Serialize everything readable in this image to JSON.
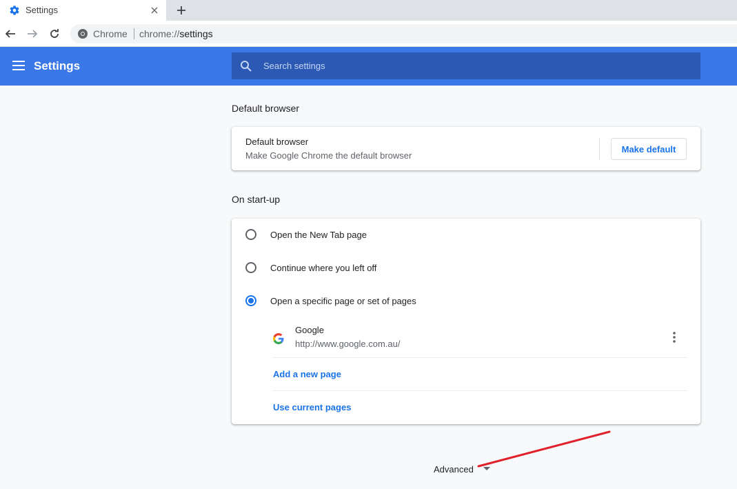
{
  "browser": {
    "tab_title": "Settings",
    "omnibox_chip": "Chrome",
    "url_scheme": "chrome://",
    "url_host": "settings"
  },
  "header": {
    "title": "Settings",
    "search_placeholder": "Search settings",
    "search_value": ""
  },
  "default_browser": {
    "section_title": "Default browser",
    "label": "Default browser",
    "description": "Make Google Chrome the default browser",
    "button_label": "Make default"
  },
  "startup": {
    "section_title": "On start-up",
    "options": [
      {
        "label": "Open the New Tab page",
        "selected": false
      },
      {
        "label": "Continue where you left off",
        "selected": false
      },
      {
        "label": "Open a specific page or set of pages",
        "selected": true
      }
    ],
    "pages": [
      {
        "name": "Google",
        "url": "http://www.google.com.au/"
      }
    ],
    "add_page_label": "Add a new page",
    "use_current_label": "Use current pages"
  },
  "advanced": {
    "label": "Advanced"
  },
  "colors": {
    "header_blue": "#3b78e7",
    "search_blue": "#2b59b4",
    "link_blue": "#1a73e8",
    "annotation_red": "#e0202a"
  }
}
